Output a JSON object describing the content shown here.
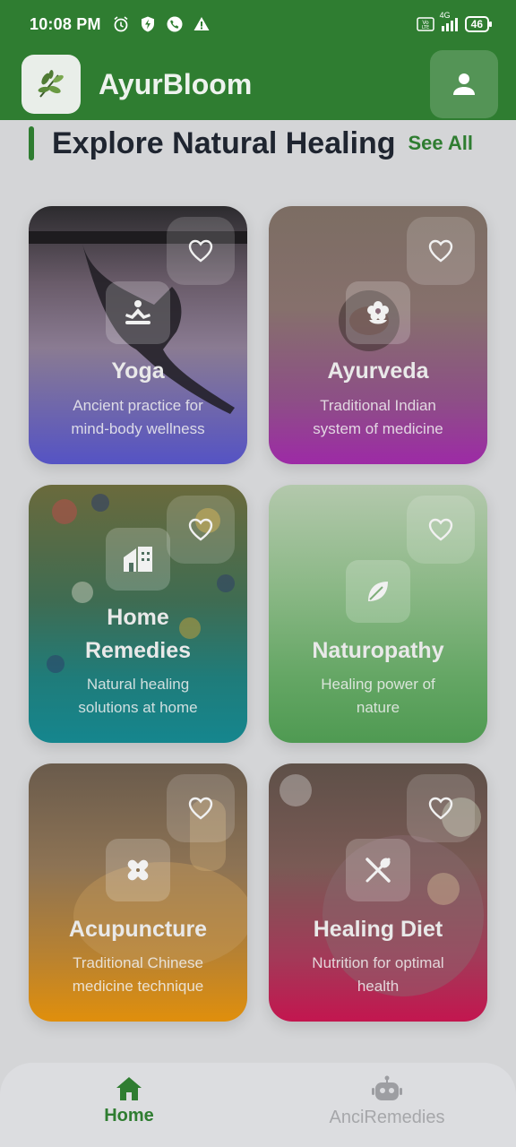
{
  "status_bar": {
    "time": "10:08 PM",
    "battery": "46",
    "network": "4G"
  },
  "app_bar": {
    "title": "AyurBloom"
  },
  "section": {
    "title": "Explore Natural Healing",
    "see_all": "See All"
  },
  "cards": [
    {
      "title": "Yoga",
      "desc_line1": "Ancient practice for",
      "desc_line2": "mind-body wellness",
      "icon": "meditation-icon",
      "colors": [
        "#2c2b2e",
        "#4a3f5c",
        "#5553c4"
      ]
    },
    {
      "title": "Ayurveda",
      "desc_line1": "Traditional Indian",
      "desc_line2": "system of medicine",
      "icon": "flower-icon",
      "colors": [
        "#7c6d63",
        "#8a5b7a",
        "#9d2aa6"
      ]
    },
    {
      "title_line1": "Home",
      "title_line2": "Remedies",
      "desc_line1": "Natural healing",
      "desc_line2": "solutions at home",
      "icon": "home-icon",
      "colors": [
        "#5a6a3a",
        "#2d6e6a",
        "#15868e"
      ]
    },
    {
      "title": "Naturopathy",
      "desc_line1": "Healing power of",
      "desc_line2": "nature",
      "icon": "leaf-icon",
      "colors": [
        "#a6c19e",
        "#75ad72",
        "#4f9a52"
      ]
    },
    {
      "title": "Acupuncture",
      "desc_line1": "Traditional Chinese",
      "desc_line2": "medicine technique",
      "icon": "bandage-icon",
      "colors": [
        "#6a5b4c",
        "#a07a3c",
        "#e08f0c"
      ]
    },
    {
      "title": "Healing Diet",
      "desc_line1": "Nutrition for optimal",
      "desc_line2": "health",
      "icon": "utensils-icon",
      "colors": [
        "#5e5048",
        "#8c4f5a",
        "#c3164f"
      ]
    }
  ],
  "bottom_nav": {
    "items": [
      {
        "label": "Home",
        "icon": "home-icon",
        "active": true
      },
      {
        "label": "AnciRemedies",
        "icon": "robot-icon",
        "active": false
      }
    ]
  },
  "colors": {
    "primary": "#2f7d31",
    "background": "#d4d5d7",
    "heading": "#1f2530"
  }
}
